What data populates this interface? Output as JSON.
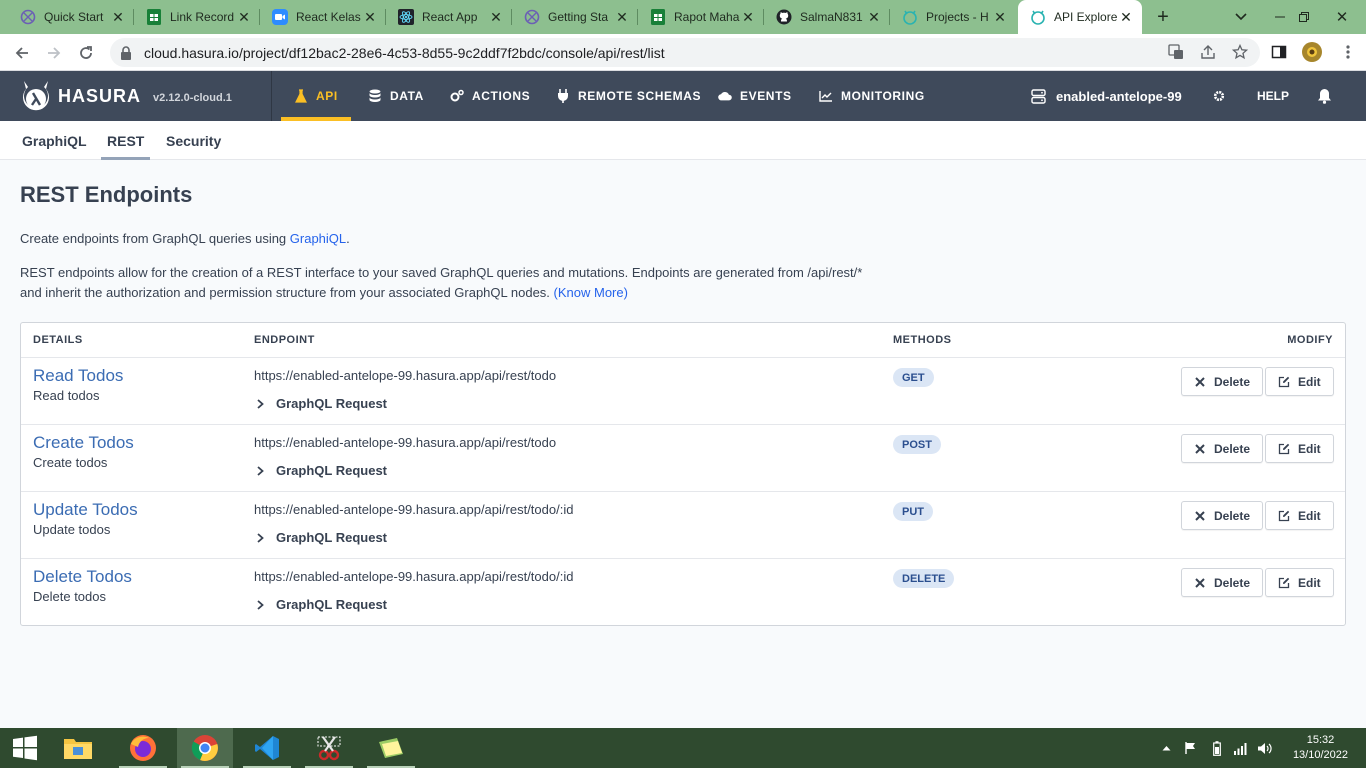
{
  "browser": {
    "tabs": [
      {
        "title": "Quick Start",
        "icon": "hasura-icon"
      },
      {
        "title": "Link Record",
        "icon": "sheets-icon"
      },
      {
        "title": "React Kelas",
        "icon": "zoom-icon"
      },
      {
        "title": "React App",
        "icon": "react-icon"
      },
      {
        "title": "Getting Sta",
        "icon": "hasura-icon"
      },
      {
        "title": "Rapot Maha",
        "icon": "sheets-icon"
      },
      {
        "title": "SalmaN831",
        "icon": "github-icon"
      },
      {
        "title": "Projects - H",
        "icon": "hasura-icon"
      },
      {
        "title": "API Explore",
        "icon": "hasura-icon"
      }
    ],
    "url": "cloud.hasura.io/project/df12bac2-28e6-4c53-8d55-9c2ddf7f2bdc/console/api/rest/list"
  },
  "header": {
    "brand": "HASURA",
    "version": "v2.12.0-cloud.1",
    "nav": [
      {
        "label": "API",
        "icon": "flask-icon"
      },
      {
        "label": "DATA",
        "icon": "database-icon"
      },
      {
        "label": "ACTIONS",
        "icon": "cogs-icon"
      },
      {
        "label": "REMOTE SCHEMAS",
        "icon": "plug-icon"
      },
      {
        "label": "EVENTS",
        "icon": "cloud-icon"
      },
      {
        "label": "MONITORING",
        "icon": "chart-line-icon"
      }
    ],
    "project": "enabled-antelope-99",
    "help": "HELP"
  },
  "subtabs": [
    "GraphiQL",
    "REST",
    "Security"
  ],
  "page": {
    "title": "REST Endpoints",
    "intro_prefix": "Create endpoints from GraphQL queries using ",
    "intro_link": "GraphiQL",
    "intro_suffix": ".",
    "desc_line1": "REST endpoints allow for the creation of a REST interface to your saved GraphQL queries and mutations. Endpoints are generated from /api/rest/*",
    "desc_line2": "and inherit the authorization and permission structure from your associated GraphQL nodes. ",
    "know_more": "(Know More)"
  },
  "table": {
    "headers": {
      "details": "DETAILS",
      "endpoint": "ENDPOINT",
      "methods": "METHODS",
      "modify": "MODIFY"
    },
    "gql_label": "GraphQL Request",
    "delete_label": "Delete",
    "edit_label": "Edit",
    "rows": [
      {
        "name": "Read Todos",
        "desc": "Read todos",
        "url": "https://enabled-antelope-99.hasura.app/api/rest/todo",
        "method": "GET"
      },
      {
        "name": "Create Todos",
        "desc": "Create todos",
        "url": "https://enabled-antelope-99.hasura.app/api/rest/todo",
        "method": "POST"
      },
      {
        "name": "Update Todos",
        "desc": "Update todos",
        "url": "https://enabled-antelope-99.hasura.app/api/rest/todo/:id",
        "method": "PUT"
      },
      {
        "name": "Delete Todos",
        "desc": "Delete todos",
        "url": "https://enabled-antelope-99.hasura.app/api/rest/todo/:id",
        "method": "DELETE"
      }
    ]
  },
  "taskbar": {
    "apps": [
      "windows-start-icon",
      "file-explorer-icon",
      "firefox-icon",
      "chrome-icon",
      "vscode-icon",
      "snipping-tool-icon",
      "sticky-notes-icon"
    ],
    "time": "15:32",
    "date": "13/10/2022"
  },
  "colors": {
    "header_bg": "#3f4a5b",
    "accent": "#fbbf24",
    "link": "#2563eb",
    "badge_bg": "#dbe6f5"
  }
}
